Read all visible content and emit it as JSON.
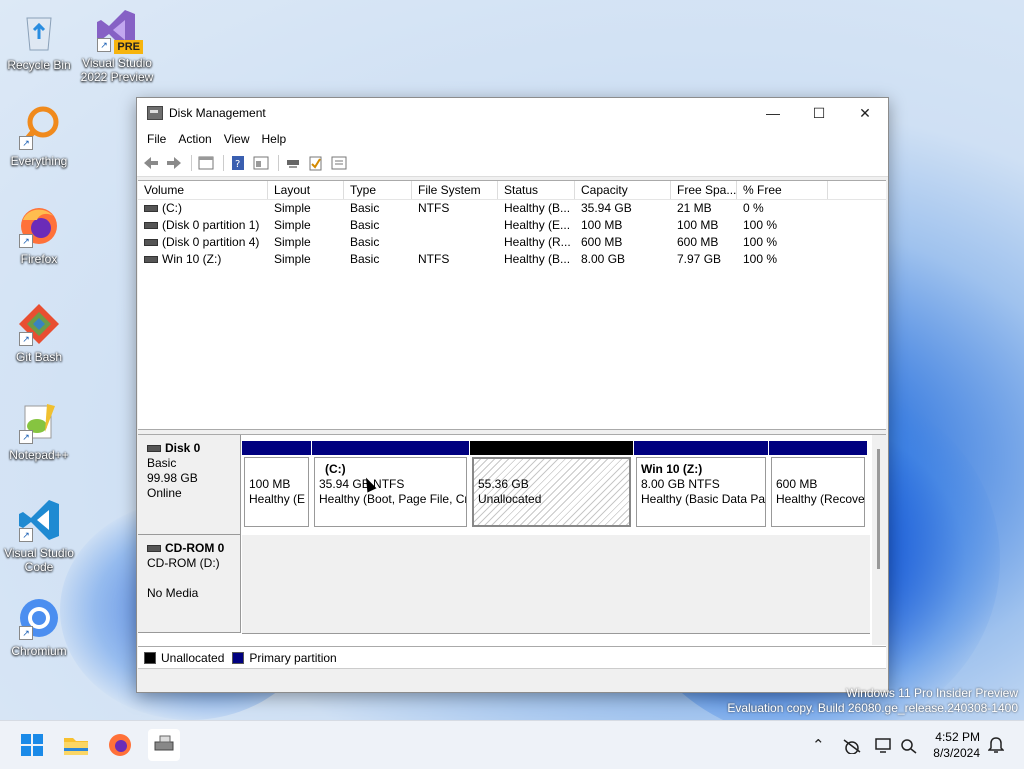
{
  "desktop": {
    "icons": [
      {
        "label": "Recycle Bin"
      },
      {
        "label": "Visual Studio 2022 Preview",
        "badge": "PRE"
      },
      {
        "label": "Everything"
      },
      {
        "label": "Firefox"
      },
      {
        "label": "Git Bash"
      },
      {
        "label": "Notepad++"
      },
      {
        "label": "Visual Studio Code"
      },
      {
        "label": "Chromium"
      }
    ]
  },
  "window": {
    "title": "Disk Management",
    "controls": {
      "minimize": "—",
      "maximize": "☐",
      "close": "✕"
    },
    "menu": [
      "File",
      "Action",
      "View",
      "Help"
    ],
    "toolbar_icons": [
      "back-arrow-icon",
      "forward-arrow-icon",
      "properties-icon",
      "help-icon",
      "view-icon",
      "connect-icon",
      "check-icon",
      "list-icon"
    ]
  },
  "volumes": {
    "columns": [
      "Volume",
      "Layout",
      "Type",
      "File System",
      "Status",
      "Capacity",
      "Free Spa...",
      "% Free"
    ],
    "rows": [
      [
        "(C:)",
        "Simple",
        "Basic",
        "NTFS",
        "Healthy (B...",
        "35.94 GB",
        "21 MB",
        "0 %"
      ],
      [
        "(Disk 0 partition 1)",
        "Simple",
        "Basic",
        "",
        "Healthy (E...",
        "100 MB",
        "100 MB",
        "100 %"
      ],
      [
        "(Disk 0 partition 4)",
        "Simple",
        "Basic",
        "",
        "Healthy (R...",
        "600 MB",
        "600 MB",
        "100 %"
      ],
      [
        "Win 10 (Z:)",
        "Simple",
        "Basic",
        "NTFS",
        "Healthy (B...",
        "8.00 GB",
        "7.97 GB",
        "100 %"
      ]
    ]
  },
  "disks": {
    "disk0": {
      "name": "Disk 0",
      "type": "Basic",
      "size": "99.98 GB",
      "status": "Online",
      "partitions": [
        {
          "title": "",
          "line1": "100 MB",
          "line2": "Healthy (E"
        },
        {
          "title": "(C:)",
          "line1": "35.94 GB NTFS",
          "line2": "Healthy (Boot, Page File, Cr"
        },
        {
          "title": "",
          "line1": "55.36 GB",
          "line2": "Unallocated"
        },
        {
          "title": "Win 10  (Z:)",
          "line1": "8.00 GB NTFS",
          "line2": "Healthy (Basic Data Pa"
        },
        {
          "title": "",
          "line1": "600 MB",
          "line2": "Healthy (Recove"
        }
      ]
    },
    "cdrom0": {
      "name": "CD-ROM 0",
      "type": "CD-ROM (D:)",
      "status": "No Media"
    }
  },
  "legend": {
    "unallocated": "Unallocated",
    "primary": "Primary partition",
    "colors": {
      "unallocated": "#000000",
      "primary": "#00007f"
    }
  },
  "watermark": {
    "line1": "Windows 11 Pro Insider Preview",
    "line2": "Evaluation copy. Build 26080.ge_release.240308-1400"
  },
  "taskbar": {
    "time": "4:52 PM",
    "date": "8/3/2024"
  }
}
